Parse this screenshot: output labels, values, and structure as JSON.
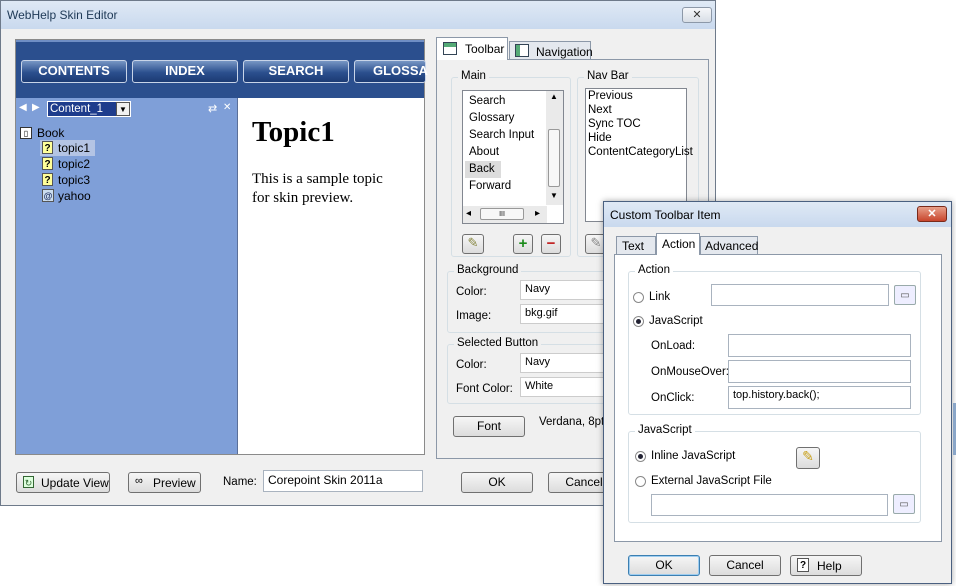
{
  "main_window": {
    "title": "WebHelp Skin Editor",
    "close_label": "✕",
    "nav_buttons": [
      "CONTENTS",
      "INDEX",
      "SEARCH",
      "GLOSSA"
    ],
    "toc": {
      "back_arrow": "◀",
      "fwd_arrow": "▶",
      "dropdown_value": "Content_1",
      "dropdown_arrow": "▼",
      "sync_glyph": "⇄",
      "close_glyph": "✕",
      "items": [
        {
          "label": "Book",
          "icon": "book-icon",
          "glyph": "📖"
        },
        {
          "label": "topic1",
          "icon": "topic-icon",
          "glyph": "?"
        },
        {
          "label": "topic2",
          "icon": "topic-icon",
          "glyph": "?"
        },
        {
          "label": "topic3",
          "icon": "topic-icon",
          "glyph": "?"
        },
        {
          "label": "yahoo",
          "icon": "remote-url-icon",
          "glyph": "@"
        }
      ]
    },
    "preview": {
      "heading": "Topic1",
      "body": "This is a sample topic for skin preview."
    },
    "bottom": {
      "update_view": "Update View",
      "preview": "Preview",
      "name_label": "Name:",
      "name_value": "Corepoint Skin 2011a",
      "ok": "OK",
      "cancel": "Cancel"
    },
    "tabs": [
      "Toolbar",
      "Navigation"
    ],
    "main_group": {
      "label": "Main",
      "items": [
        "Search",
        "Glossary",
        "Search Input",
        "About",
        "Back",
        "Forward"
      ],
      "selected": "Back",
      "hscroll_glyph": "III",
      "up": "▲",
      "down": "▼",
      "left": "◂",
      "right": "▸",
      "add": "+",
      "remove": "−"
    },
    "navbar_group": {
      "label": "Nav Bar",
      "items": [
        "Previous",
        "Next",
        "Sync TOC",
        "Hide",
        "ContentCategoryList"
      ]
    },
    "background_group": {
      "label": "Background",
      "color_label": "Color:",
      "color_value": "Navy",
      "image_label": "Image:",
      "image_value": "bkg.gif"
    },
    "selected_button_group": {
      "label": "Selected Button",
      "color_label": "Color:",
      "color_value": "Navy",
      "font_color_label": "Font Color:",
      "font_color_value": "White"
    },
    "font_button": "Font",
    "font_value": "Verdana, 8pt,"
  },
  "dialog": {
    "title": "Custom Toolbar Item",
    "close_label": "✕",
    "tabs": [
      "Text",
      "Action",
      "Advanced"
    ],
    "action_group": {
      "label": "Action",
      "link_label": "Link",
      "link_value": "",
      "javascript_label": "JavaScript",
      "onload_label": "OnLoad:",
      "onload_value": "",
      "onmouseover_label": "OnMouseOver:",
      "onmouseover_value": "",
      "onclick_label": "OnClick:",
      "onclick_value": "top.history.back();"
    },
    "javascript_group": {
      "label": "JavaScript",
      "inline_label": "Inline JavaScript",
      "external_label": "External JavaScript File",
      "external_value": ""
    },
    "folder_glyph": "📂",
    "ok": "OK",
    "cancel": "Cancel",
    "help": "Help",
    "help_glyph": "?"
  },
  "colors": {
    "toc_background": "#7f9fd8",
    "nav_blue": "#2b4f8e",
    "window_bg": "#f0f0f0"
  }
}
